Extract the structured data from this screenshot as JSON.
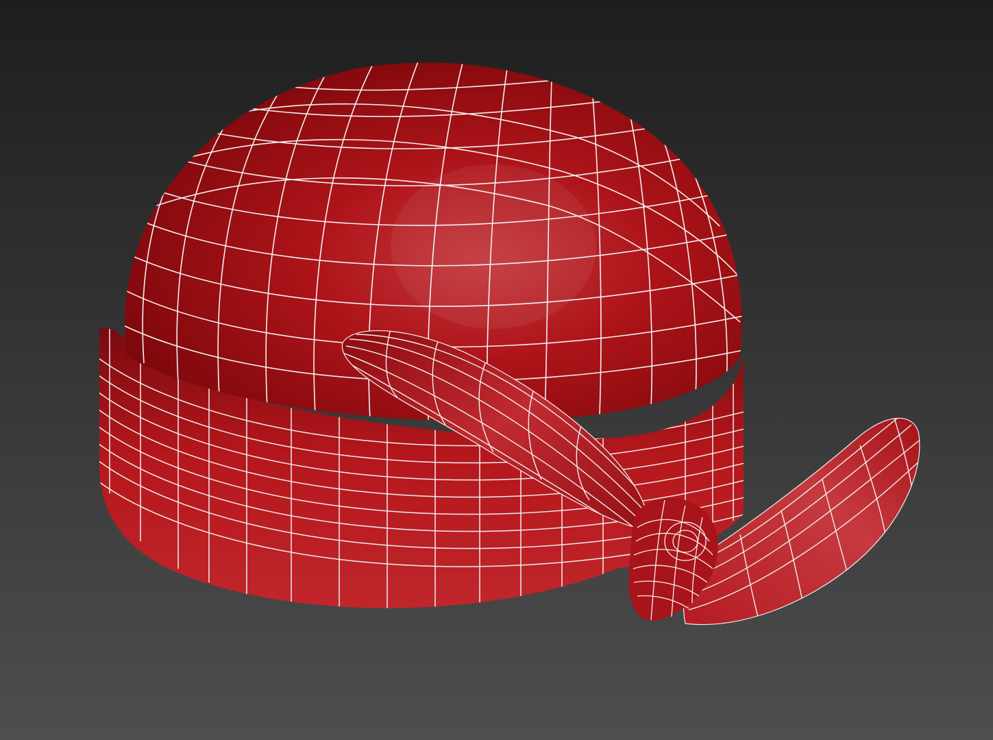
{
  "scene": {
    "object_icon": "bandana-mesh-icon",
    "background_top_color": "#1e1e1e",
    "background_bottom_color": "#4e4e4e",
    "mesh_color": "#b0141a",
    "mesh_highlight_color": "#c8343a",
    "mesh_shadow_color": "#6e0a0e",
    "wire_color": "#f2f2f2"
  }
}
